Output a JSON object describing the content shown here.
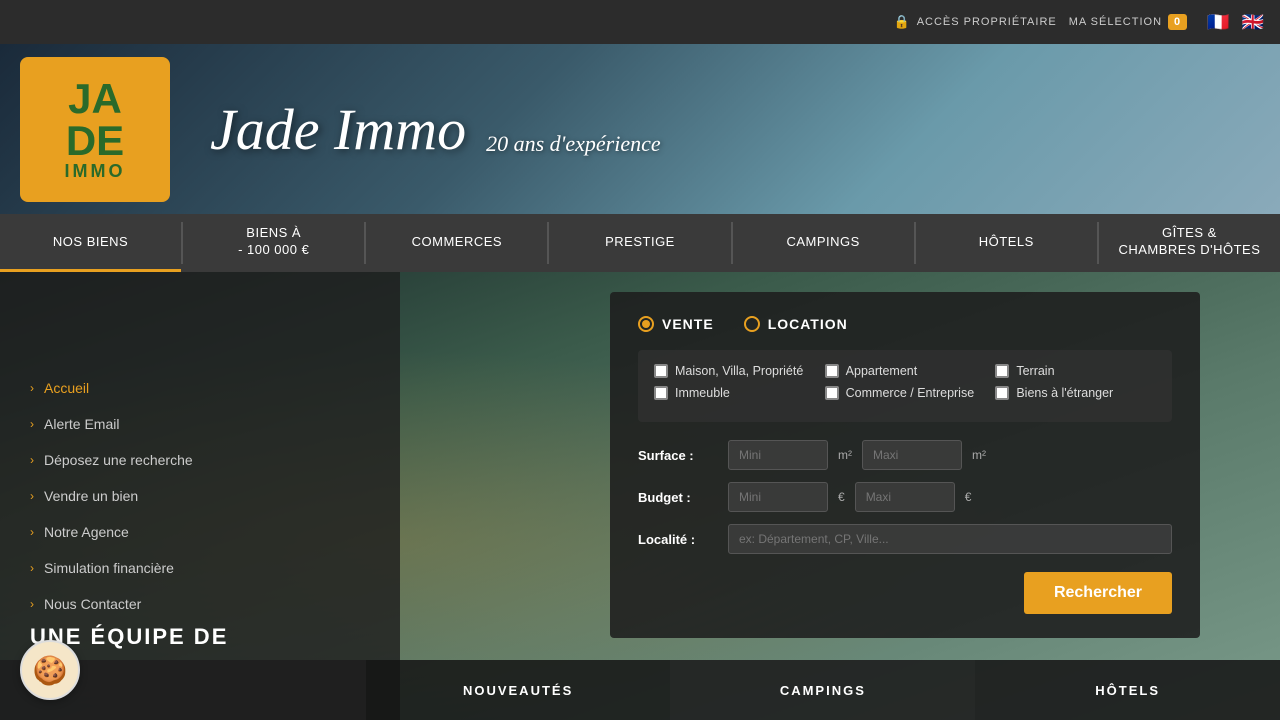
{
  "topbar": {
    "access_label": "ACCÈS PROPRIÉTAIRE",
    "selection_label": "MA SÉLECTION",
    "selection_count": "0"
  },
  "header": {
    "title": "Jade Immo",
    "subtitle": "20 ans d'expérience",
    "logo_ja": "JA",
    "logo_de": "DE",
    "logo_immo": "IMMO"
  },
  "nav": {
    "items": [
      {
        "label": "Nos biens",
        "active": true
      },
      {
        "label": "Biens à\n- 100 000 €",
        "active": false
      },
      {
        "label": "Commerces",
        "active": false
      },
      {
        "label": "Prestige",
        "active": false
      },
      {
        "label": "Campings",
        "active": false
      },
      {
        "label": "Hôtels",
        "active": false
      },
      {
        "label": "Gîtes &\nChambres d'Hôtes",
        "active": false
      }
    ]
  },
  "sidebar": {
    "items": [
      {
        "label": "Accueil",
        "active": true
      },
      {
        "label": "Alerte Email",
        "active": false
      },
      {
        "label": "Déposez une recherche",
        "active": false
      },
      {
        "label": "Vendre un bien",
        "active": false
      },
      {
        "label": "Notre Agence",
        "active": false
      },
      {
        "label": "Simulation financière",
        "active": false
      },
      {
        "label": "Nous Contacter",
        "active": false
      }
    ]
  },
  "search": {
    "radio_vente": "VENTE",
    "radio_location": "LOCATION",
    "checkboxes": [
      {
        "label": "Maison, Villa, Propriété",
        "checked": false
      },
      {
        "label": "Appartement",
        "checked": false
      },
      {
        "label": "Terrain",
        "checked": false
      },
      {
        "label": "Immeuble",
        "checked": false
      },
      {
        "label": "Commerce / Entreprise",
        "checked": false
      },
      {
        "label": "Biens à l'étranger",
        "checked": false
      }
    ],
    "surface_label": "Surface :",
    "surface_mini_placeholder": "Mini",
    "surface_mini_unit": "m²",
    "surface_maxi_placeholder": "Maxi",
    "surface_maxi_unit": "m²",
    "budget_label": "Budget :",
    "budget_mini_placeholder": "Mini",
    "budget_mini_unit": "€",
    "budget_maxi_placeholder": "Maxi",
    "budget_maxi_unit": "€",
    "localite_label": "Localité :",
    "localite_placeholder": "ex: Département, CP, Ville...",
    "search_button": "Rechercher"
  },
  "bottom_tabs": [
    {
      "label": "UNE ÉQUIPE DE"
    },
    {
      "label": "NOUVEAUTÉS"
    },
    {
      "label": "CAMPINGS"
    },
    {
      "label": "HÔTELS"
    }
  ],
  "cookie_icon": "🍪"
}
